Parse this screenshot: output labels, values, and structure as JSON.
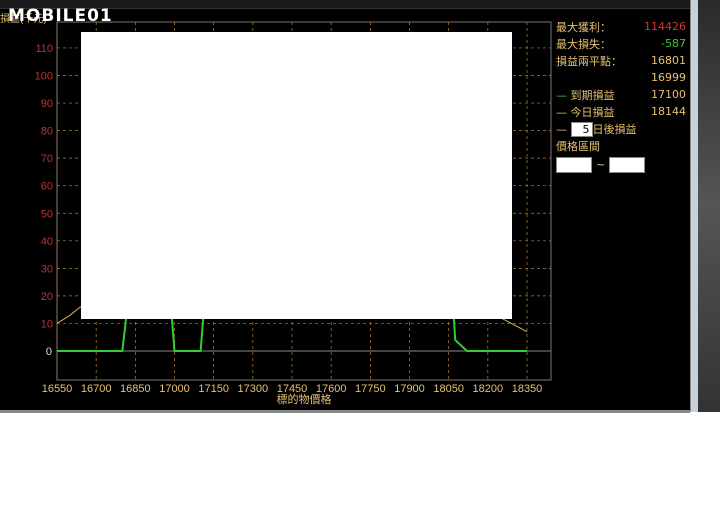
{
  "watermark": "MOBILE01",
  "panel": {
    "max_profit_label": "最大獲利：",
    "max_profit": "114426",
    "max_loss_label": "最大損失：",
    "max_loss": "-587",
    "breakeven_label": "損益兩平點：",
    "breakeven": [
      "16801",
      "16999",
      "17100",
      "18144"
    ],
    "expiry_label": "到期損益",
    "today_label": "今日損益",
    "days_value": "5",
    "days_after_label": "日後損益",
    "price_range_label": "價格區間",
    "range_from": "",
    "range_to": "",
    "tilde": "~"
  },
  "colors": {
    "expiry": "#30d030",
    "today": "#d8b060",
    "grid": "#b08040"
  },
  "chart_data": {
    "type": "line",
    "title": "",
    "xlabel": "標的物價格",
    "ylabel": "損益(千元)",
    "xlim": [
      16550,
      18350
    ],
    "ylim": [
      -10,
      120
    ],
    "xticks": [
      16550,
      16700,
      16850,
      17000,
      17150,
      17300,
      17450,
      17600,
      17750,
      17900,
      18050,
      18200,
      18350
    ],
    "yticks": [
      0,
      10,
      20,
      30,
      40,
      50,
      60,
      70,
      80,
      90,
      100,
      110
    ],
    "series": [
      {
        "name": "到期損益",
        "x": [
          16550,
          16800,
          16815,
          16990,
          17000,
          17100,
          17110,
          17600,
          18070,
          18075,
          18120,
          18350
        ],
        "y": [
          0,
          0,
          12,
          12,
          0,
          0,
          12,
          12,
          12,
          4,
          0,
          0
        ]
      },
      {
        "name": "今日損益",
        "x": [
          16550,
          16600,
          16640,
          18250,
          18350
        ],
        "y": [
          10,
          13,
          16,
          12,
          7
        ]
      }
    ]
  }
}
